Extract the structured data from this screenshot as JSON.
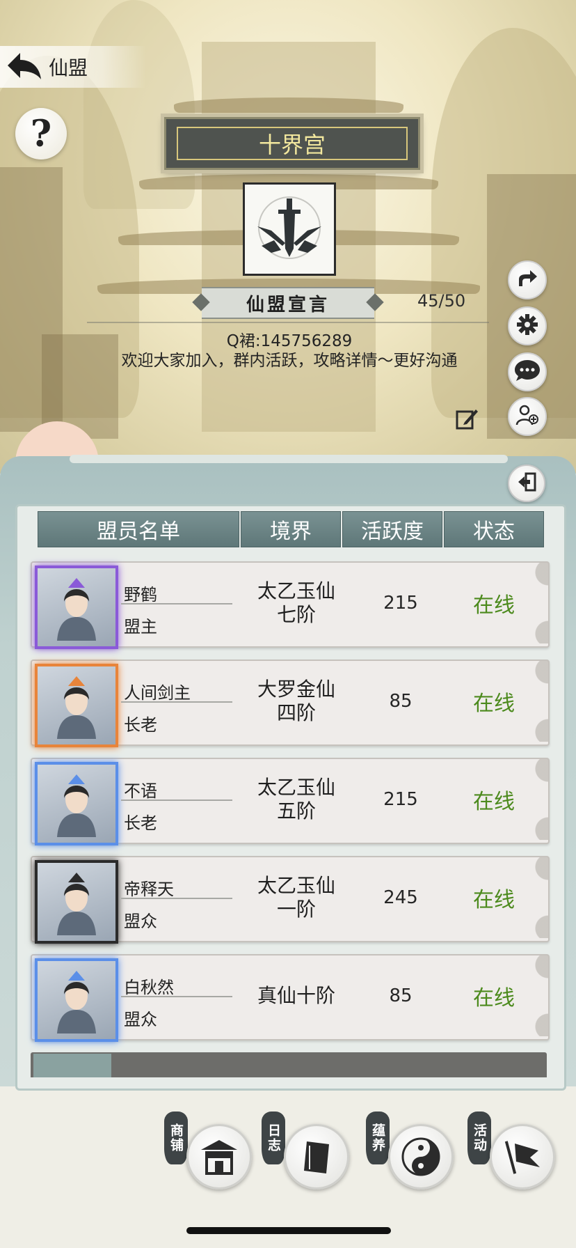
{
  "header": {
    "back_icon": "back-arrow-icon",
    "title": "仙盟",
    "help_label": "?"
  },
  "alliance": {
    "name": "十界宫",
    "emblem_icon": "crossed-swords-emblem-icon",
    "declaration_label": "仙盟宣言",
    "member_count": "45/50",
    "declaration_line1": "Q裙:145756289",
    "declaration_line2": "欢迎大家加入，群内活跃，攻略详情～更好沟通"
  },
  "side_actions": [
    {
      "icon": "share-icon"
    },
    {
      "icon": "gear-icon"
    },
    {
      "icon": "chat-bubble-icon"
    },
    {
      "icon": "add-member-icon"
    }
  ],
  "table": {
    "headers": [
      "盟员名单",
      "境界",
      "活跃度",
      "状态"
    ],
    "rows": [
      {
        "name": "野鹤",
        "role": "盟主",
        "realm": "太乙玉仙\n七阶",
        "activity": "215",
        "status": "在线",
        "frame_color": "#8a5ad8"
      },
      {
        "name": "人间剑主",
        "role": "长老",
        "realm": "大罗金仙\n四阶",
        "activity": "85",
        "status": "在线",
        "frame_color": "#e8843a"
      },
      {
        "name": "不语",
        "role": "长老",
        "realm": "太乙玉仙\n五阶",
        "activity": "215",
        "status": "在线",
        "frame_color": "#5b8fe8"
      },
      {
        "name": "帝释天",
        "role": "盟众",
        "realm": "太乙玉仙\n一阶",
        "activity": "245",
        "status": "在线",
        "frame_color": "#2b2b2b"
      },
      {
        "name": "白秋然",
        "role": "盟众",
        "realm": "真仙十阶",
        "activity": "85",
        "status": "在线",
        "frame_color": "#5b8fe8"
      }
    ]
  },
  "bottom_nav": [
    {
      "label": "商铺",
      "icon": "shop-icon"
    },
    {
      "label": "日志",
      "icon": "book-icon"
    },
    {
      "label": "蕴养",
      "icon": "yin-yang-icon"
    },
    {
      "label": "活动",
      "icon": "flag-icon"
    }
  ],
  "colors": {
    "online_status": "#4c8a1d",
    "header_bg": "#6b8586",
    "plate_text": "#f2e79e"
  }
}
